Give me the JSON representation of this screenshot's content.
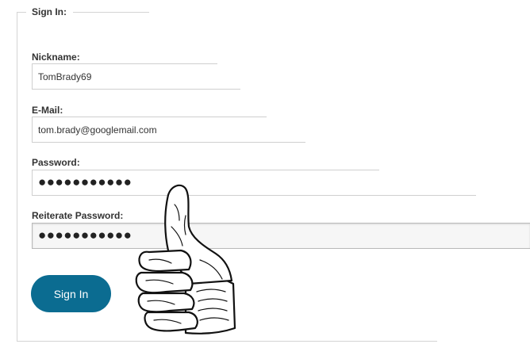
{
  "form": {
    "legend": "Sign In:",
    "fields": [
      {
        "label": "Nickname:",
        "value": "TomBrady69"
      },
      {
        "label": "E-Mail:",
        "value": "tom.brady@googlemail.com"
      },
      {
        "label": "Password:",
        "value": "●●●●●●●●●●●"
      },
      {
        "label": "Reiterate Password:",
        "value": "●●●●●●●●●●●"
      }
    ],
    "submit_label": "Sign In"
  },
  "colors": {
    "button_bg": "#0b6c91",
    "button_text": "#ffffff",
    "border": "#cfcfcf"
  },
  "icons": {
    "thumbs_up": "thumbs-up-hand-drawing"
  }
}
